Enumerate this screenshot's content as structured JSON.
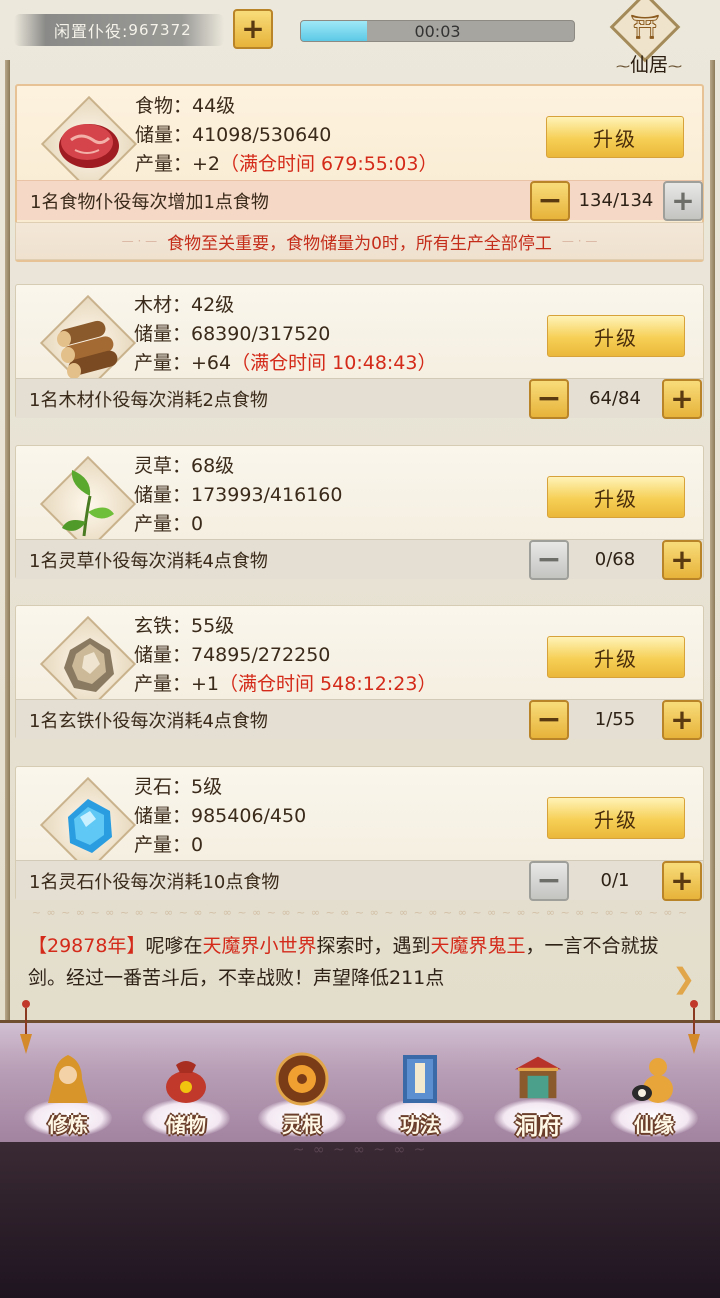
{
  "top": {
    "idle_workers_label": "闲置仆役:",
    "idle_workers_count": "967372",
    "add_label": "+",
    "timer": "00:03",
    "timer_progress": 0.24,
    "residence_label": "仙居"
  },
  "resources": [
    {
      "name_line": "食物：44级",
      "storage_line": "储量：41098/530640",
      "output_prefix": "产量：+2",
      "output_note": "（满仓时间 679:55:03）",
      "upgrade_label": "升级",
      "worker_desc": "1名食物仆役每次增加1点食物",
      "worker_count": "134/134",
      "icon": "meat-icon"
    },
    {
      "name_line": "木材：42级",
      "storage_line": "储量：68390/317520",
      "output_prefix": "产量：+64",
      "output_note": "（满仓时间 10:48:43）",
      "upgrade_label": "升级",
      "worker_desc": "1名木材仆役每次消耗2点食物",
      "worker_count": "64/84",
      "icon": "wood-icon"
    },
    {
      "name_line": "灵草：68级",
      "storage_line": "储量：173993/416160",
      "output_prefix": "产量：0",
      "output_note": "",
      "upgrade_label": "升级",
      "worker_desc": "1名灵草仆役每次消耗4点食物",
      "worker_count": "0/68",
      "icon": "herb-icon"
    },
    {
      "name_line": "玄铁：55级",
      "storage_line": "储量：74895/272250",
      "output_prefix": "产量：+1",
      "output_note": "（满仓时间 548:12:23）",
      "upgrade_label": "升级",
      "worker_desc": "1名玄铁仆役每次消耗4点食物",
      "worker_count": "1/55",
      "icon": "iron-ore-icon"
    },
    {
      "name_line": "灵石：5级",
      "storage_line": "储量：985406/450",
      "output_prefix": "产量：0",
      "output_note": "",
      "upgrade_label": "升级",
      "worker_desc": "1名灵石仆役每次消耗10点食物",
      "worker_count": "0/1",
      "icon": "spirit-stone-icon"
    }
  ],
  "food_notice": "食物至关重要，食物储量为0时，所有生产全部停工",
  "log": {
    "year": "【29878年】",
    "who": "呢嗲在",
    "place": "天魔界小世界",
    "mid": "探索时，遇到",
    "enemy": "天魔界鬼王",
    "rest": "，一言不合就拔剑。经过一番苦斗后，不幸战败！声望降低211点"
  },
  "nav": [
    {
      "label": "修炼",
      "icon": "cultivation-icon"
    },
    {
      "label": "储物",
      "icon": "storage-bag-icon"
    },
    {
      "label": "灵根",
      "icon": "spirit-root-icon"
    },
    {
      "label": "功法",
      "icon": "scripture-book-icon"
    },
    {
      "label": "洞府",
      "icon": "cave-mansion-icon"
    },
    {
      "label": "仙缘",
      "icon": "gourd-icon"
    }
  ],
  "colors": {
    "accent_gold": "#f6cf55",
    "warning_red": "#d42a1a",
    "nav_bg": "#b89eb6"
  }
}
